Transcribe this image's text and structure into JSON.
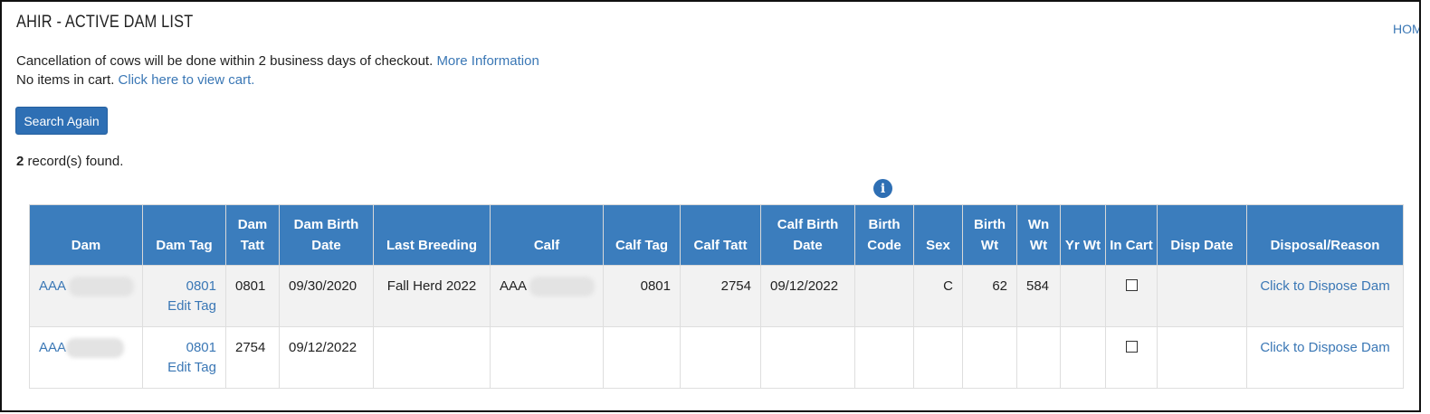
{
  "header": {
    "title": "AHIR - ACTIVE DAM LIST",
    "home_link": "HOME"
  },
  "notice": {
    "cancellation_text": "Cancellation of cows will be done within 2 business days of checkout.",
    "more_info_link": "More Information",
    "cart_text": "No items in cart.",
    "view_cart_link": "Click here to view cart."
  },
  "actions": {
    "search_again_label": "Search Again"
  },
  "results": {
    "count": "2",
    "suffix": "record(s) found."
  },
  "colors": {
    "header_bg": "#3b7dbd",
    "link": "#3a77b5",
    "button_bg": "#2e6fb4"
  },
  "table": {
    "columns": [
      "Dam",
      "Dam Tag",
      "Dam Tatt",
      "Dam Birth Date",
      "Last Breeding",
      "Calf",
      "Calf Tag",
      "Calf Tatt",
      "Calf Birth Date",
      "Birth Code",
      "Sex",
      "Birth Wt",
      "Wn Wt",
      "Yr Wt",
      "In Cart",
      "Disp Date",
      "Disposal/Reason"
    ],
    "rows": [
      {
        "dam_prefix": "AAA",
        "dam_tag": "0801",
        "edit_tag": "Edit Tag",
        "dam_tatt": "0801",
        "dam_birth_date": "09/30/2020",
        "last_breeding": "Fall Herd 2022",
        "calf_prefix": "AAA",
        "calf_tag": "0801",
        "calf_tatt": "2754",
        "calf_birth_date": "09/12/2022",
        "birth_code": "",
        "sex": "C",
        "birth_wt": "62",
        "wn_wt": "584",
        "yr_wt": "",
        "in_cart": false,
        "disp_date": "",
        "disposal_link": "Click to Dispose Dam"
      },
      {
        "dam_prefix": "AAA",
        "dam_tag": "0801",
        "edit_tag": "Edit Tag",
        "dam_tatt": "2754",
        "dam_birth_date": "09/12/2022",
        "last_breeding": "",
        "calf_prefix": "",
        "calf_tag": "",
        "calf_tatt": "",
        "calf_birth_date": "",
        "birth_code": "",
        "sex": "",
        "birth_wt": "",
        "wn_wt": "",
        "yr_wt": "",
        "in_cart": false,
        "disp_date": "",
        "disposal_link": "Click to Dispose Dam"
      }
    ]
  }
}
